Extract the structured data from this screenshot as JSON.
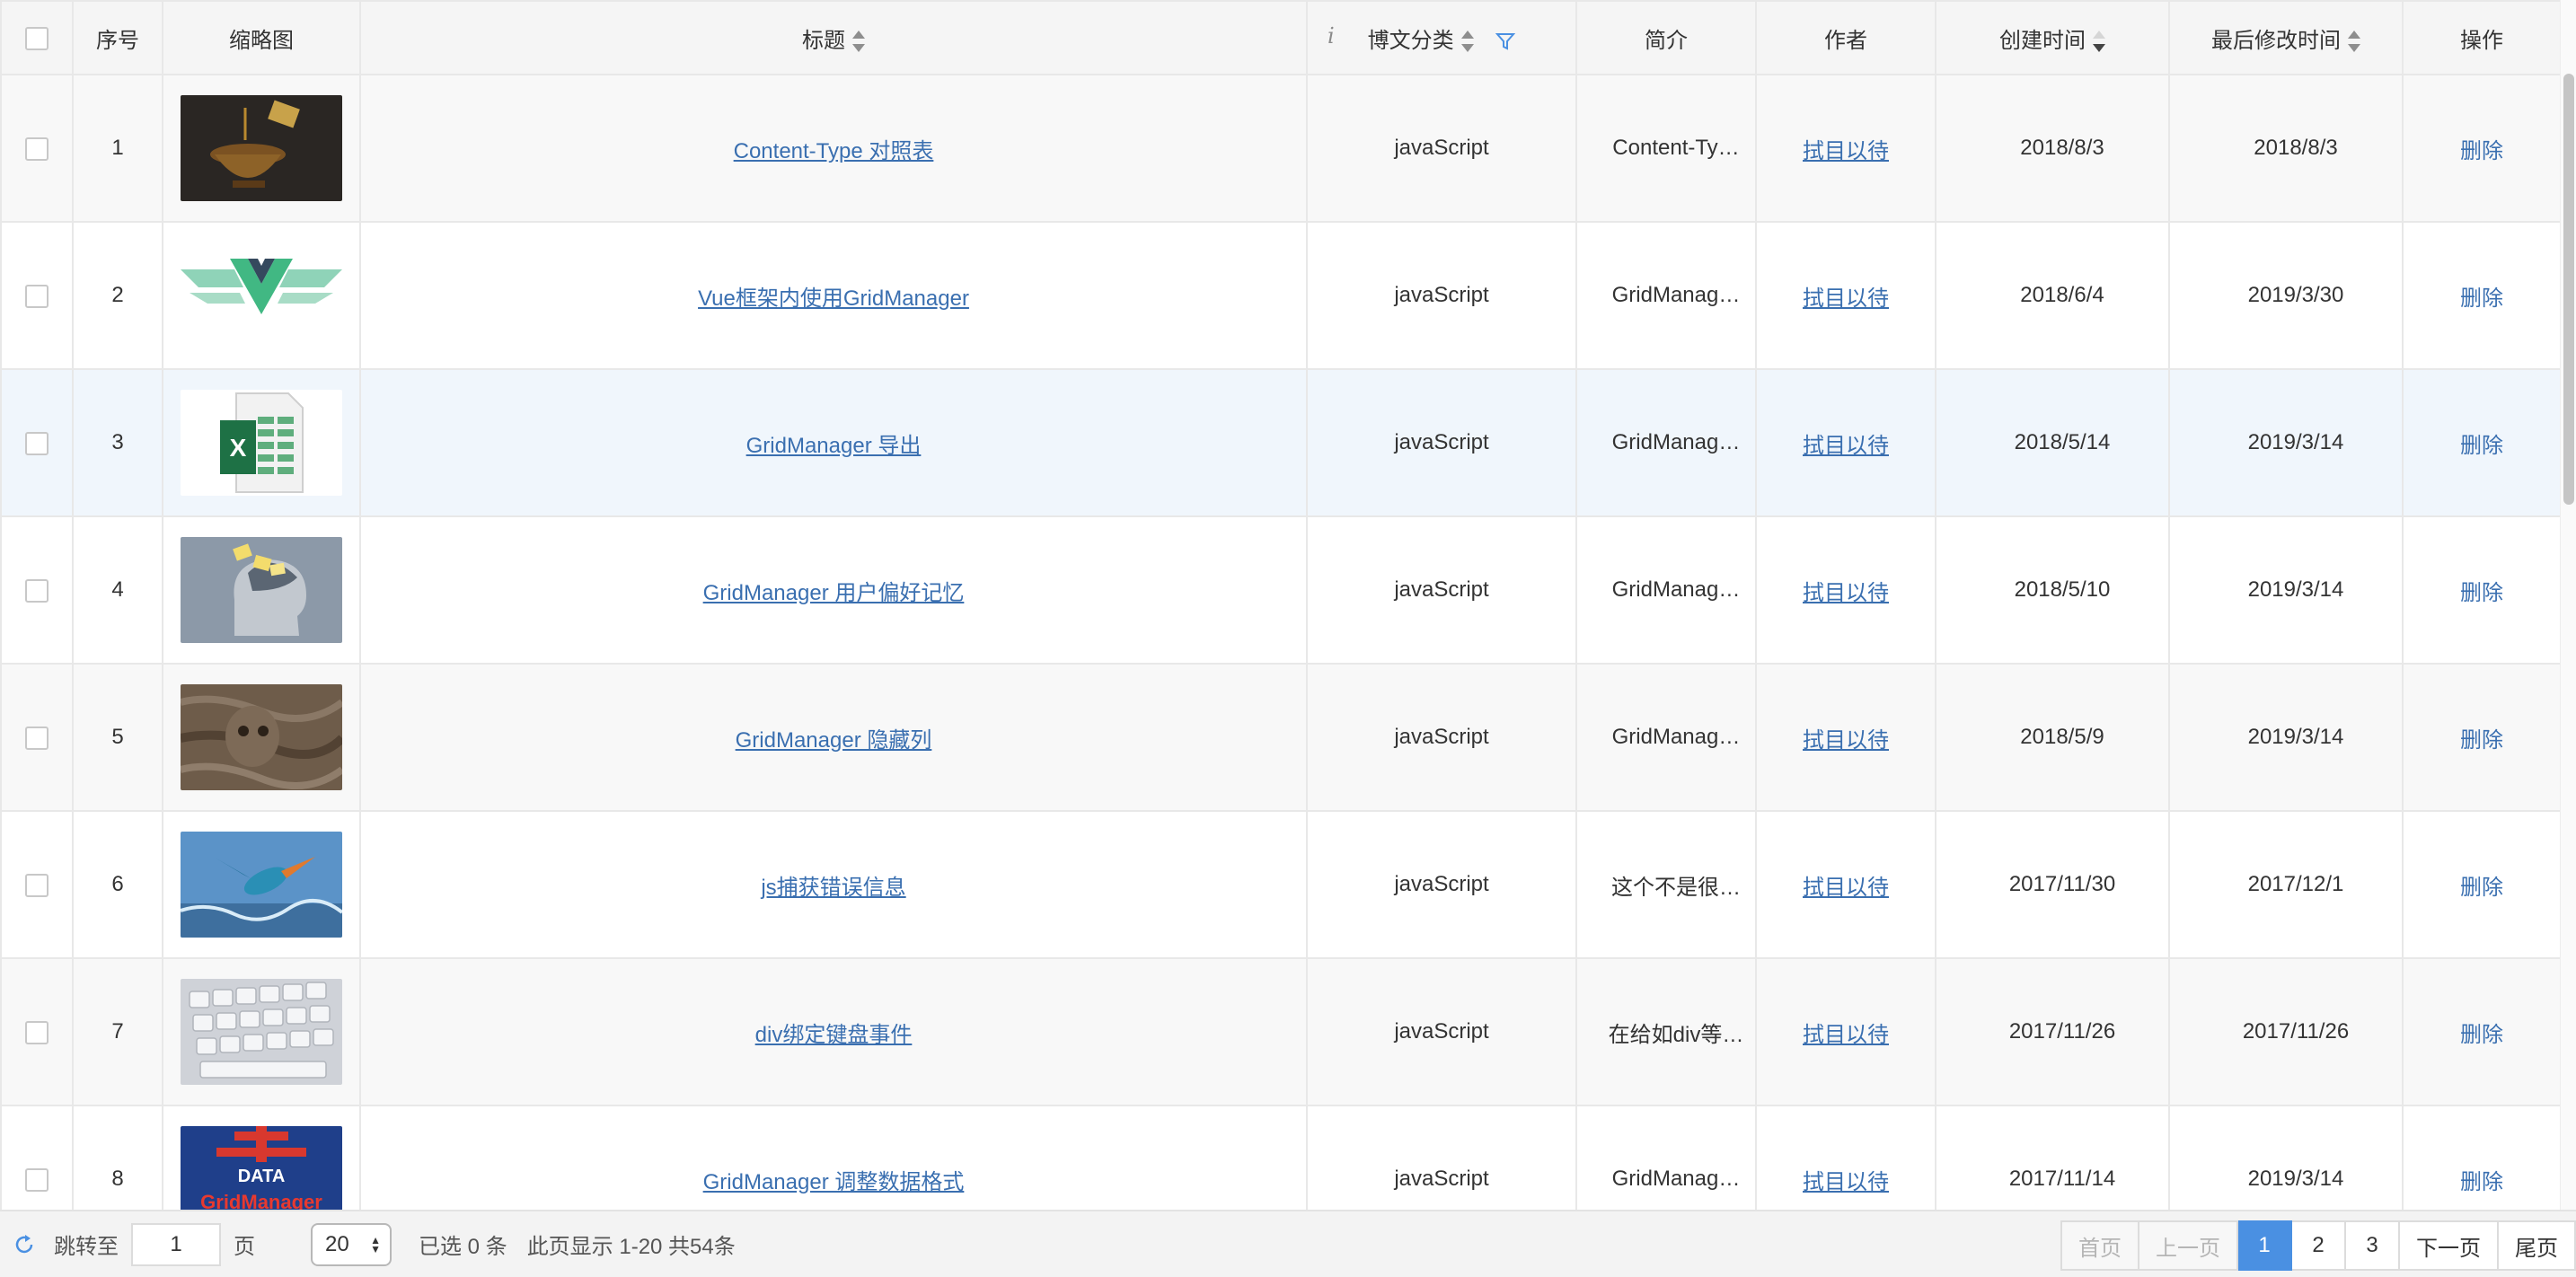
{
  "columns": {
    "index": "序号",
    "thumbnail": "缩略图",
    "title": "标题",
    "category": "博文分类",
    "summary": "简介",
    "author": "作者",
    "created": "创建时间",
    "modified": "最后修改时间",
    "actions": "操作"
  },
  "rows": [
    {
      "index": "1",
      "thumb": "incense-burner",
      "title": "Content-Type 对照表",
      "category": "javaScript",
      "summary": "Content-Ty…",
      "author": "拭目以待",
      "created": "2018/8/3",
      "modified": "2018/8/3",
      "action": "删除"
    },
    {
      "index": "2",
      "thumb": "vue-logo",
      "title": "Vue框架内使用GridManager",
      "category": "javaScript",
      "summary": "GridManag…",
      "author": "拭目以待",
      "created": "2018/6/4",
      "modified": "2019/3/30",
      "action": "删除"
    },
    {
      "index": "3",
      "thumb": "excel-icon",
      "title": "GridManager 导出",
      "category": "javaScript",
      "summary": "GridManag…",
      "author": "拭目以待",
      "created": "2018/5/14",
      "modified": "2019/3/14",
      "action": "删除"
    },
    {
      "index": "4",
      "thumb": "memory-head",
      "title": "GridManager 用户偏好记忆",
      "category": "javaScript",
      "summary": "GridManag…",
      "author": "拭目以待",
      "created": "2018/5/10",
      "modified": "2019/3/14",
      "action": "删除"
    },
    {
      "index": "5",
      "thumb": "owl-bark",
      "title": "GridManager 隐藏列",
      "category": "javaScript",
      "summary": "GridManag…",
      "author": "拭目以待",
      "created": "2018/5/9",
      "modified": "2019/3/14",
      "action": "删除"
    },
    {
      "index": "6",
      "thumb": "kingfisher",
      "title": "js捕获错误信息",
      "category": "javaScript",
      "summary": "这个不是很…",
      "author": "拭目以待",
      "created": "2017/11/30",
      "modified": "2017/12/1",
      "action": "删除"
    },
    {
      "index": "7",
      "thumb": "keyboard",
      "title": "div绑定键盘事件",
      "category": "javaScript",
      "summary": "在给如div等…",
      "author": "拭目以待",
      "created": "2017/11/26",
      "modified": "2017/11/26",
      "action": "删除"
    },
    {
      "index": "8",
      "thumb": "data-gridmanager",
      "title": "GridManager 调整数据格式",
      "category": "javaScript",
      "summary": "GridManag…",
      "author": "拭目以待",
      "created": "2017/11/14",
      "modified": "2019/3/14",
      "action": "删除"
    }
  ],
  "thumb_text": {
    "excel_letter": "X",
    "data_top": "DATA",
    "data_bottom": "GridManager"
  },
  "footer": {
    "goto_label": "跳转至",
    "goto_value": "1",
    "page_unit": "页",
    "page_size": "20",
    "selected_text": "已选 0 条",
    "range_text": "此页显示 1-20 共54条",
    "pager": {
      "first": "首页",
      "prev": "上一页",
      "pages": [
        "1",
        "2",
        "3"
      ],
      "active_page": "1",
      "next": "下一页",
      "last": "尾页"
    }
  },
  "colors": {
    "link": "#3a6fb0",
    "active_page": "#4a90e2",
    "filter_icon": "#4a90e2"
  },
  "icons": [
    "checkbox",
    "sort-arrows-icon",
    "sort-desc-icon",
    "filter-icon",
    "info-icon",
    "refresh-icon"
  ]
}
